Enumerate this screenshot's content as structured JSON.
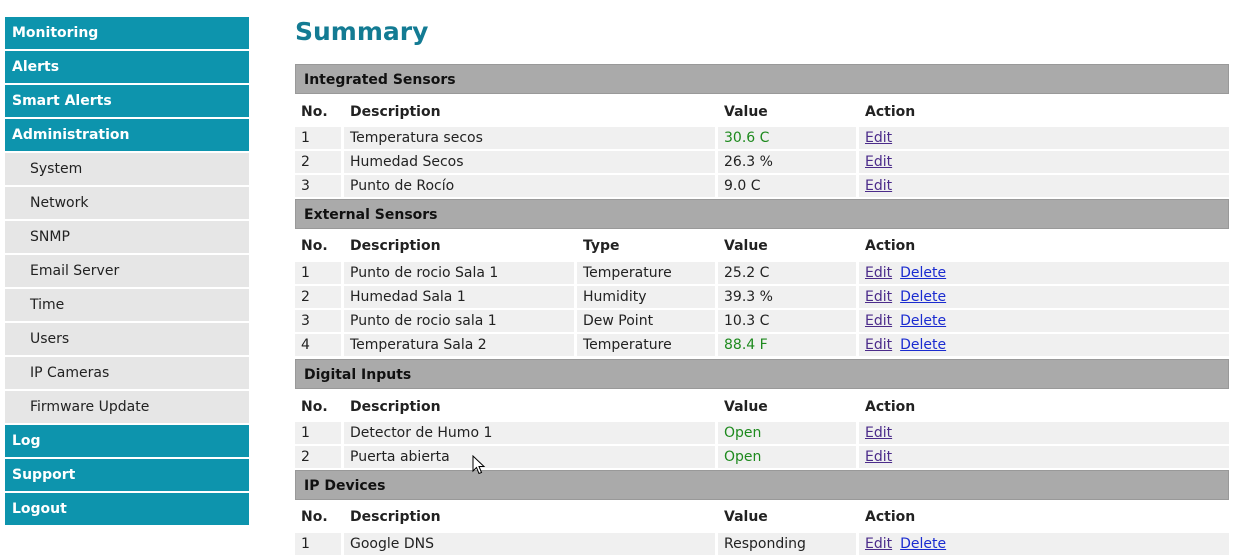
{
  "sidebar": {
    "items": [
      {
        "label": "Monitoring",
        "type": "main"
      },
      {
        "label": "Alerts",
        "type": "main"
      },
      {
        "label": "Smart Alerts",
        "type": "main"
      },
      {
        "label": "Administration",
        "type": "main"
      },
      {
        "label": "System",
        "type": "sub"
      },
      {
        "label": "Network",
        "type": "sub"
      },
      {
        "label": "SNMP",
        "type": "sub"
      },
      {
        "label": "Email Server",
        "type": "sub"
      },
      {
        "label": "Time",
        "type": "sub"
      },
      {
        "label": "Users",
        "type": "sub"
      },
      {
        "label": "IP Cameras",
        "type": "sub"
      },
      {
        "label": "Firmware Update",
        "type": "sub"
      },
      {
        "label": "Log",
        "type": "main"
      },
      {
        "label": "Support",
        "type": "main"
      },
      {
        "label": "Logout",
        "type": "main"
      }
    ]
  },
  "page": {
    "title": "Summary"
  },
  "columns": {
    "no": "No.",
    "description": "Description",
    "type": "Type",
    "value": "Value",
    "action": "Action"
  },
  "actions": {
    "edit": "Edit",
    "delete": "Delete"
  },
  "colors": {
    "accent": "#0d94ad",
    "title": "#137b93",
    "ok_value": "#1e8a1e"
  },
  "integrated_sensors": {
    "title": "Integrated Sensors",
    "rows": [
      {
        "no": "1",
        "description": "Temperatura secos",
        "value": "30.6 C",
        "highlight": true
      },
      {
        "no": "2",
        "description": "Humedad Secos",
        "value": "26.3 %",
        "highlight": false
      },
      {
        "no": "3",
        "description": "Punto de Rocío",
        "value": "9.0 C",
        "highlight": false
      }
    ]
  },
  "external_sensors": {
    "title": "External Sensors",
    "rows": [
      {
        "no": "1",
        "description": "Punto de rocio Sala 1",
        "type": "Temperature",
        "value": "25.2 C",
        "highlight": false
      },
      {
        "no": "2",
        "description": "Humedad Sala 1",
        "type": "Humidity",
        "value": "39.3 %",
        "highlight": false
      },
      {
        "no": "3",
        "description": "Punto de rocio sala 1",
        "type": "Dew Point",
        "value": "10.3 C",
        "highlight": false
      },
      {
        "no": "4",
        "description": "Temperatura Sala 2",
        "type": "Temperature",
        "value": "88.4 F",
        "highlight": true
      }
    ]
  },
  "digital_inputs": {
    "title": "Digital Inputs",
    "rows": [
      {
        "no": "1",
        "description": "Detector de Humo 1",
        "value": "Open",
        "highlight": true
      },
      {
        "no": "2",
        "description": "Puerta abierta",
        "value": "Open",
        "highlight": true
      }
    ]
  },
  "ip_devices": {
    "title": "IP Devices",
    "rows": [
      {
        "no": "1",
        "description": "Google DNS",
        "value": "Responding",
        "highlight": false
      }
    ]
  }
}
